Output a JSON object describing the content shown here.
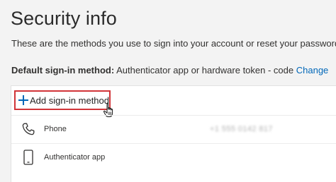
{
  "header": {
    "title": "Security info",
    "subtitle": "These are the methods you use to sign into your account or reset your password."
  },
  "default_method": {
    "label": "Default sign-in method:",
    "value": "Authenticator app or hardware token - code",
    "change_link": "Change"
  },
  "methods_card": {
    "add_button_label": "Add sign-in method",
    "add_button_icon": "plus-icon",
    "items": [
      {
        "icon": "phone-icon",
        "label": "Phone",
        "value": "+1 555 0142 817"
      },
      {
        "icon": "smartphone-icon",
        "label": "Authenticator app",
        "value": ""
      }
    ]
  },
  "colors": {
    "accent": "#0067b8",
    "highlight_border": "#d13438",
    "page_background": "#f3f3f3",
    "card_background": "#ffffff"
  }
}
